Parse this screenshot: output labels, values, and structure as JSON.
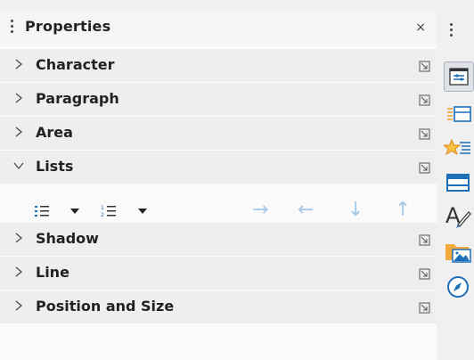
{
  "panel": {
    "title": "Properties",
    "close": "×",
    "sections": [
      {
        "label": "Character"
      },
      {
        "label": "Paragraph"
      },
      {
        "label": "Area"
      },
      {
        "label": "Lists"
      },
      {
        "label": "Shadow"
      },
      {
        "label": "Line"
      },
      {
        "label": "Position and Size"
      }
    ],
    "lists_arrows": {
      "demote": "→",
      "promote": "←",
      "move_down": "↓",
      "move_up": "↑"
    }
  },
  "colors": {
    "panel_bg": "#fafafa",
    "section_bg": "#eeeeee",
    "arrow_disabled": "#a6c8e8",
    "icon_blue": "#1e6fb8",
    "icon_orange": "#f0a030"
  },
  "sidebar_icons": [
    "properties-icon",
    "styles-icon",
    "gallery-icon",
    "page-icon",
    "fontwork-icon",
    "image-folder-icon",
    "navigator-icon"
  ]
}
